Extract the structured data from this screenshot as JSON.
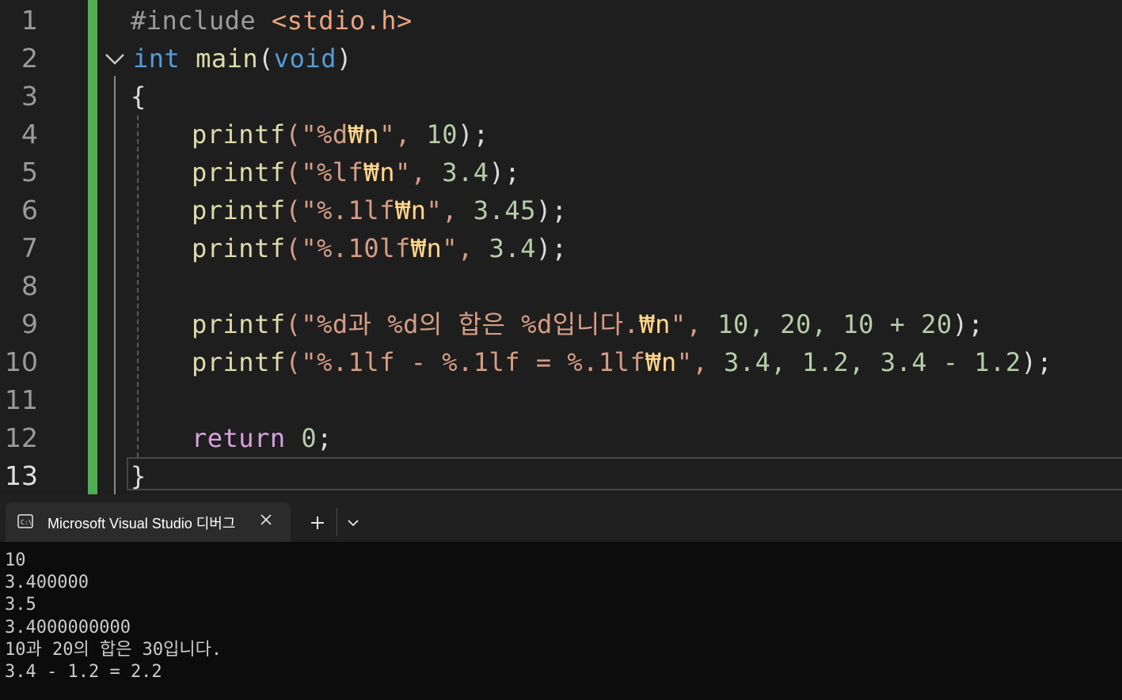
{
  "editor": {
    "line_numbers": [
      "1",
      "2",
      "3",
      "4",
      "5",
      "6",
      "7",
      "8",
      "9",
      "10",
      "11",
      "12",
      "13"
    ],
    "current_line": "13",
    "code": {
      "l1": {
        "directive": "#include",
        "header": "<stdio.h>"
      },
      "l2": {
        "type": "int",
        "name": "main",
        "open": "(",
        "param": "void",
        "close": ")"
      },
      "l3": {
        "brace": "{"
      },
      "l4": {
        "fn": "printf",
        "p1": "(\"",
        "fmt": "%d",
        "esc": "₩n",
        "p2": "\", ",
        "args": "10",
        "end": ");"
      },
      "l5": {
        "fn": "printf",
        "p1": "(\"",
        "fmt": "%lf",
        "esc": "₩n",
        "p2": "\", ",
        "args": "3.4",
        "end": ");"
      },
      "l6": {
        "fn": "printf",
        "p1": "(\"",
        "fmt": "%.1lf",
        "esc": "₩n",
        "p2": "\", ",
        "args": "3.45",
        "end": ");"
      },
      "l7": {
        "fn": "printf",
        "p1": "(\"",
        "fmt": "%.10lf",
        "esc": "₩n",
        "p2": "\", ",
        "args": "3.4",
        "end": ");"
      },
      "l9": {
        "fn": "printf",
        "p1": "(\"",
        "fmt": "%d과 %d의 합은 %d입니다.",
        "esc": "₩n",
        "p2": "\", ",
        "args": "10, 20, 10 + 20",
        "end": ");"
      },
      "l10": {
        "fn": "printf",
        "p1": "(\"",
        "fmt": "%.1lf - %.1lf = %.1lf",
        "esc": "₩n",
        "p2": "\", ",
        "args": "3.4, 1.2, 3.4 - 1.2",
        "end": ");"
      },
      "l12": {
        "keyword": "return",
        "value": "0",
        "end": ";"
      },
      "l13": {
        "brace": "}"
      }
    }
  },
  "terminal": {
    "tab_title": "Microsoft Visual Studio 디버그",
    "tab_icon": "console-icon",
    "output": [
      "10",
      "3.400000",
      "3.5",
      "3.4000000000",
      "10과 20의 합은 30입니다.",
      "3.4 - 1.2 = 2.2"
    ]
  },
  "colors": {
    "change_bar": "#4caf50",
    "keyword": "#569cd6",
    "function": "#dcdcaa",
    "string": "#d69d85",
    "escape": "#ffd68a",
    "number": "#b5cea8",
    "control": "#d8a0df"
  }
}
